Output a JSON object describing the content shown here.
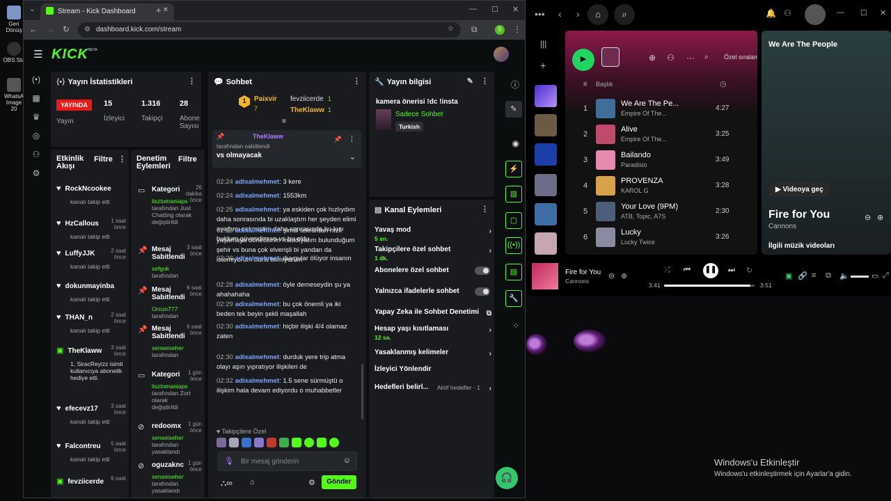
{
  "desktop": {
    "icons": [
      {
        "label": "Geri Dönüş"
      },
      {
        "label": "OBS Stu"
      },
      {
        "label": "WhatsA Image 20"
      }
    ],
    "watermark": {
      "title": "Windows'u Etkinleştir",
      "subtitle": "Windows'u etkinleştirmek için Ayarlar'a gidin."
    }
  },
  "browser": {
    "tab_title": "Stream - Kick Dashboard",
    "url": "dashboard.kick.com/stream",
    "profile_initial": "0"
  },
  "kick": {
    "logo": "KICK",
    "logo_badge": "BETA",
    "stats": {
      "title": "Yayın İstatistikleri",
      "live_badge": "YAYINDA",
      "live_label": "Yayın",
      "items": [
        {
          "value": "15",
          "label": "İzleyici"
        },
        {
          "value": "1.316",
          "label": "Takipçi"
        },
        {
          "value": "28",
          "label": "Abone Sayısı"
        }
      ]
    },
    "activity": {
      "title": "Etkinlik Akışı",
      "filter": "Filtre",
      "rows": [
        {
          "name": "RockNcookee",
          "time": "",
          "sub": "kanalı takip etti"
        },
        {
          "name": "HzCallous",
          "time": "1 saat önce",
          "sub": "kanalı takip etti"
        },
        {
          "name": "LuffyJJK",
          "time": "2 saat önce",
          "sub": "kanalı takip etti"
        },
        {
          "name": "dokunmayinba",
          "time": "",
          "sub": "kanalı takip etti"
        },
        {
          "name": "THAN_n",
          "time": "2 saat önce",
          "sub": "kanalı takip etti"
        },
        {
          "name": "TheKlaww",
          "time": "3 saat önce",
          "sub": "1, SiracReyizz isimli kullanıcıya abonelik hediye etti."
        },
        {
          "name": "efecevz17",
          "time": "3 saat önce",
          "sub": "kanalı takip etti"
        },
        {
          "name": "Falcontreu",
          "time": "5 saat önce",
          "sub": "kanalı takip etti"
        },
        {
          "name": "fevziicerde",
          "time": "6 saat",
          "sub": ""
        }
      ]
    },
    "moderation": {
      "title": "Denetim Eylemleri",
      "filter": "Filtre",
      "rows": [
        {
          "name": "Kategori",
          "time": "26 dakika önce",
          "green": "lisztomaniaps",
          "sub": "tarafından Just Chatting olarak değiştirildi"
        },
        {
          "name": "Mesaj Sabitlendi",
          "time": "3 saat önce",
          "green": "sefgok",
          "sub": "tarafından"
        },
        {
          "name": "Mesaj Sabitlendi",
          "time": "6 saat önce",
          "green": "Orcun777",
          "sub": "tarafından"
        },
        {
          "name": "Mesaj Sabitlendi",
          "time": "6 saat önce",
          "green": "senseiseher",
          "sub": "tarafından"
        },
        {
          "name": "Kategori",
          "time": "1 gün önce",
          "green": "lisztomaniaps",
          "sub": "tarafından Zort olarak değiştirildi"
        },
        {
          "name": "redoomx",
          "time": "1 gün önce",
          "green": "senseiseher",
          "sub": "tarafından yasaklandı"
        },
        {
          "name": "oguzaknc",
          "time": "1 gün önce",
          "green": "senseiseher",
          "sub": "tarafından yasaklandı"
        }
      ]
    },
    "chat": {
      "title": "Sohbet",
      "top_gifters": [
        {
          "name": "Paixvir",
          "count": "7"
        },
        {
          "name": "fevziicerde",
          "count": "1"
        },
        {
          "name": "TheKlaww",
          "count": "1"
        }
      ],
      "pinned": {
        "user": "TheKlaww",
        "by": "tarafından sabitlendi",
        "text": "vs olmayacak"
      },
      "messages": [
        {
          "time": "02:24",
          "user": "adixalmehmet",
          "text": "3 kere"
        },
        {
          "time": "02:24",
          "user": "adixalmehmet",
          "text": "1553km"
        },
        {
          "time": "02:25",
          "user": "adixalmehmet",
          "text": "ya eskiden çok hızlıydım daha sonrasında bi uzaklaştım her şeyden elimi ayağımı çekmiştim daha sonrasında bu kızı buldum güvendim vs vs bu oldu"
        },
        {
          "time": "02:26",
          "user": "adixalmehmet",
          "text": "şimdi tekrardan hızlı yaşamaya dönebilirim maddiyatım bulunduğum şehir vs buna çok elverişli bi yandan da istemiyorum bunu bilmiyorum"
        },
        {
          "time": "02:26",
          "user": "adixalmehmet",
          "text": "duygular ölüyor insanın"
        },
        {
          "time": "02:28",
          "user": "adixalmehmet",
          "text": "öyle demeseydin şu ya ahahahaha"
        },
        {
          "time": "02:29",
          "user": "adixalmehmet",
          "text": "bu çok önemli ya iki beden tek beyin şekli maşallah"
        },
        {
          "time": "02:30",
          "user": "adixalmehmet",
          "text": "hiçbir ilişki 4/4 olamaz zaten"
        },
        {
          "time": "02:30",
          "user": "adixalmehmet",
          "text": "durduk yere trip atma olayı aşırı yıpratıyor ilişkileri de"
        },
        {
          "time": "02:32",
          "user": "adixalmehmet",
          "text": "1.5 sene sürmüştü o ilişkim hala devam ediyordu o muhabbetler"
        }
      ],
      "followers_only": "Takipçilere Özel",
      "input_placeholder": "Bir mesaj gönderin",
      "send": "Gönder"
    },
    "stream_info": {
      "title": "Yayın bilgisi",
      "stream_title": "kamera önerisi !dc !insta",
      "category": "Sadece Sohbet",
      "tag": "Turkish"
    },
    "channel_actions": {
      "title": "Kanal Eylemleri",
      "rows": [
        {
          "label": "Yavaş mod",
          "sub": "5 sn."
        },
        {
          "label": "Takipçilere özel sohbet",
          "sub": "1 dk."
        },
        {
          "label": "Abonelere özel sohbet",
          "sub": ""
        },
        {
          "label": "Yalnızca ifadelerle sohbet",
          "sub": ""
        },
        {
          "label": "Yapay Zeka ile Sohbet Denetimi",
          "sub": ""
        },
        {
          "label": "Hesap yaşı kısıtlaması",
          "sub": "12 sa."
        },
        {
          "label": "Yasaklanmış kelimeler",
          "sub": ""
        },
        {
          "label": "İzleyici Yönlendir",
          "sub": ""
        },
        {
          "label": "Hedefleri belirl...",
          "sub": ""
        }
      ],
      "goals_status": "Aktif hedefler - 1"
    }
  },
  "spotify": {
    "header_col": "Başlık",
    "search_hint": "Özel sıralam",
    "tracks": [
      {
        "num": "1",
        "title": "We Are The Pe...",
        "artist": "Empire Of The...",
        "duration": "4:27"
      },
      {
        "num": "2",
        "title": "Alive",
        "artist": "Empire Of The...",
        "duration": "3:25"
      },
      {
        "num": "3",
        "title": "Bailando",
        "artist": "Paradisio",
        "duration": "3:49"
      },
      {
        "num": "4",
        "title": "PROVENZA",
        "artist": "KAROL G",
        "duration": "3:28"
      },
      {
        "num": "5",
        "title": "Your Love (9PM)",
        "artist": "ATB, Topic, A7S",
        "duration": "2:30"
      },
      {
        "num": "6",
        "title": "Lucky",
        "artist": "Lucky Twice",
        "duration": "3:26"
      }
    ],
    "right_panel": {
      "top_title": "We Are The People",
      "video_button": "Videoya geç",
      "now_title": "Fire for You",
      "now_artist": "Cannons",
      "related": "İlgili müzik videoları"
    },
    "player": {
      "title": "Fire for You",
      "artist": "Cannons",
      "elapsed": "3:41",
      "total": "3:51",
      "progress": 0.955
    }
  }
}
